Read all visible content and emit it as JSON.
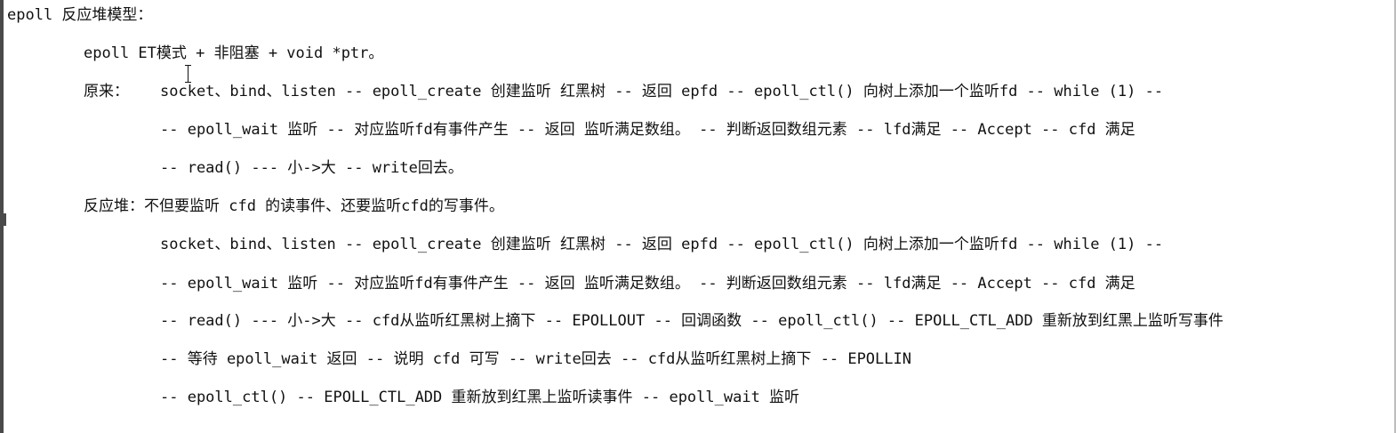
{
  "title": "epoll 反应堆模型：",
  "subtitle": "epoll ET模式 + 非阻塞 + void *ptr。",
  "original": {
    "label": "原来：",
    "lines": [
      "socket、bind、listen -- epoll_create 创建监听 红黑树 --  返回 epfd -- epoll_ctl() 向树上添加一个监听fd -- while (1) --",
      "-- epoll_wait 监听 -- 对应监听fd有事件产生 -- 返回 监听满足数组。 -- 判断返回数组元素 -- lfd满足 -- Accept -- cfd 满足",
      "-- read() --- 小->大 -- write回去。"
    ]
  },
  "reactor": {
    "heading": "反应堆：不但要监听 cfd 的读事件、还要监听cfd的写事件。",
    "lines": [
      "socket、bind、listen -- epoll_create 创建监听 红黑树 --  返回 epfd -- epoll_ctl() 向树上添加一个监听fd -- while (1) --",
      "-- epoll_wait 监听 -- 对应监听fd有事件产生 -- 返回 监听满足数组。 -- 判断返回数组元素 -- lfd满足 -- Accept -- cfd 满足",
      "-- read() --- 小->大 -- cfd从监听红黑树上摘下 -- EPOLLOUT -- 回调函数 -- epoll_ctl() -- EPOLL_CTL_ADD 重新放到红黑上监听写事件",
      "-- 等待 epoll_wait 返回 -- 说明 cfd 可写 -- write回去 -- cfd从监听红黑树上摘下 -- EPOLLIN",
      "-- epoll_ctl() -- EPOLL_CTL_ADD 重新放到红黑上监听读事件 -- epoll_wait 监听"
    ]
  }
}
